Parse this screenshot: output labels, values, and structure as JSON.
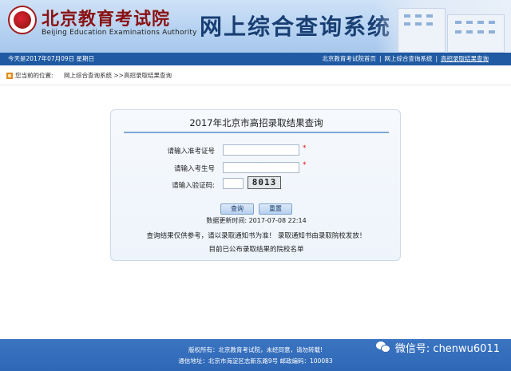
{
  "header": {
    "logo_title": "北京教育考试院",
    "logo_subtitle": "Beijing Education Examinations Authority",
    "system_title": "网上综合查询系统"
  },
  "infobar": {
    "date": "今天是2017年07月09日 星期日",
    "links": [
      "北京教育考试院首页",
      "网上综合查询系统",
      "高招录取结果查询"
    ]
  },
  "breadcrumb": {
    "label": "您当前的位置:",
    "path": "网上综合查询系统 >>高招录取结果查询"
  },
  "panel": {
    "title": "2017年北京市高招录取结果查询",
    "fields": [
      {
        "label": "请输入准考证号",
        "value": "",
        "required": "*"
      },
      {
        "label": "请输入考生号",
        "value": "",
        "required": "*"
      },
      {
        "label": "请输入验证码:",
        "value": ""
      }
    ],
    "captcha": "8013",
    "buttons": {
      "query": "查询",
      "reset": "重置"
    },
    "update_time": "数据更新时间:  2017-07-08 22:14",
    "notice": "查询结果仅供参考，请以录取通知书为准！ 录取通知书由录取院校发放！",
    "published": "目前已公布录取结果的院校名单"
  },
  "footer": {
    "line1": "版权所有：北京教育考试院，未经同意，请勿转载!",
    "line2": "通信地址：北京市海淀区志新东路9号 邮政编码：100083"
  },
  "watermark": {
    "text": "微信号: chenwu6011",
    "icon": "wechat-icon"
  }
}
